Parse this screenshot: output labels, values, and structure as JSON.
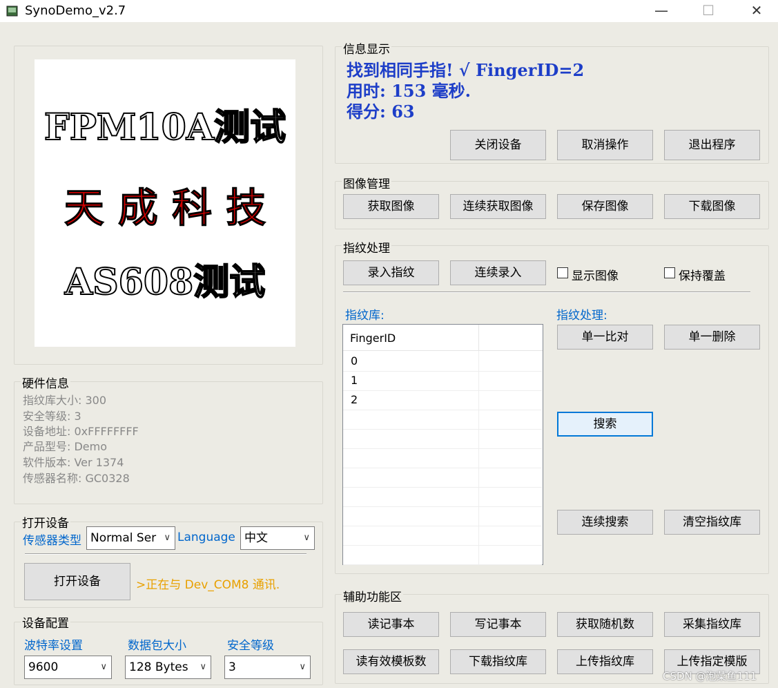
{
  "window": {
    "title": "SynoDemo_v2.7",
    "minimize": "—",
    "maximize": "☐",
    "close": "✕"
  },
  "logo": {
    "line1": "FPM10A测试",
    "line2": "天 成 科 技",
    "line3": "AS608测试"
  },
  "hardware": {
    "legend": "硬件信息",
    "lines": [
      "指纹库大小: 300",
      "安全等级: 3",
      "设备地址: 0xFFFFFFFF",
      "产品型号:  Demo",
      "软件版本: Ver 1374",
      "传感器名称: GC0328"
    ]
  },
  "open_device": {
    "legend": "打开设备",
    "sensor_type_label": "传感器类型",
    "sensor_type_value": "Normal Ser",
    "language_label": "Language",
    "language_value": "中文",
    "open_button": "打开设备",
    "status_text": ">正在与 Dev_COM8 通讯."
  },
  "config": {
    "legend": "设备配置",
    "baud_label": "波特率设置",
    "baud_value": "9600",
    "packet_label": "数据包大小",
    "packet_value": "128 Bytes",
    "security_label": "安全等级",
    "security_value": "3"
  },
  "info": {
    "legend": "信息显示",
    "line1": "找到相同手指! √  FingerID=2",
    "line2": "用时: 153 毫秒.",
    "line3": "得分: 63",
    "buttons": [
      "关闭设备",
      "取消操作",
      "退出程序"
    ]
  },
  "image_mgmt": {
    "legend": "图像管理",
    "buttons": [
      "获取图像",
      "连续获取图像",
      "保存图像",
      "下载图像"
    ]
  },
  "finger": {
    "legend": "指纹处理",
    "enroll_button": "录入指纹",
    "continuous_enroll_button": "连续录入",
    "show_image_label": "显示图像",
    "keep_cover_label": "保持覆盖",
    "library_label": "指纹库:",
    "process_label": "指纹处理:",
    "list_header": "FingerID",
    "list_rows": [
      "0",
      "1",
      "2",
      "",
      "",
      "",
      "",
      "",
      ""
    ],
    "match_button": "单一比对",
    "delete_button": "单一删除",
    "search_button": "搜索",
    "continuous_search_button": "连续搜索",
    "clear_button": "清空指纹库"
  },
  "aux": {
    "legend": "辅助功能区",
    "buttons": [
      "读记事本",
      "写记事本",
      "获取随机数",
      "采集指纹库",
      "读有效模板数",
      "下载指纹库",
      "上传指纹库",
      "上传指定模版"
    ]
  },
  "watermark": "CSDN @泡菜鱼111",
  "colors": {
    "info_text": "#1d3ec8",
    "label_blue": "#0066cc",
    "status_orange": "#e8a000",
    "logo_red": "#d40000"
  }
}
